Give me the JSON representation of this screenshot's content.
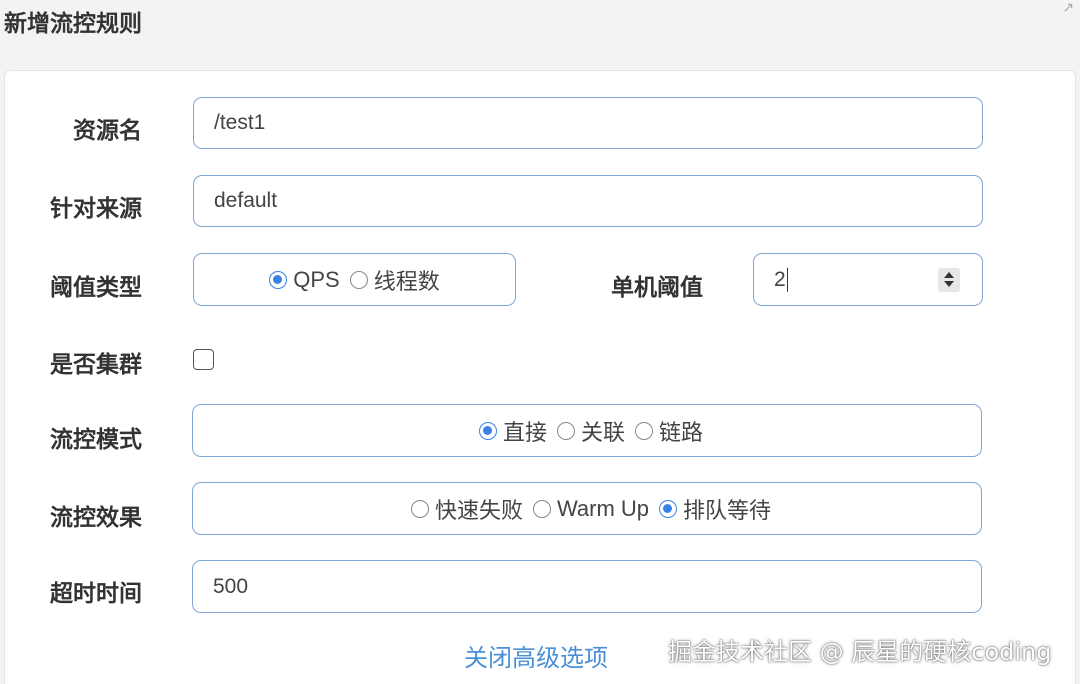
{
  "dialog": {
    "title": "新增流控规则"
  },
  "form": {
    "resource_name": {
      "label": "资源名",
      "value": "/test1"
    },
    "limit_app": {
      "label": "针对来源",
      "value": "default"
    },
    "grade": {
      "label": "阈值类型",
      "options": [
        "QPS",
        "线程数"
      ],
      "selected": "QPS"
    },
    "count": {
      "label": "单机阈值",
      "value": "2"
    },
    "cluster": {
      "label": "是否集群",
      "checked": false
    },
    "strategy": {
      "label": "流控模式",
      "options": [
        "直接",
        "关联",
        "链路"
      ],
      "selected": "直接"
    },
    "control_behavior": {
      "label": "流控效果",
      "options": [
        "快速失败",
        "Warm Up",
        "排队等待"
      ],
      "selected": "排队等待"
    },
    "timeout": {
      "label": "超时时间",
      "value": "500"
    }
  },
  "advanced_toggle_label": "关闭高级选项",
  "watermark": "掘金技术社区 @ 辰星的硬核coding",
  "colors": {
    "accent": "#3b82e6",
    "border": "#7fa7d6",
    "link": "#4a90d9"
  }
}
